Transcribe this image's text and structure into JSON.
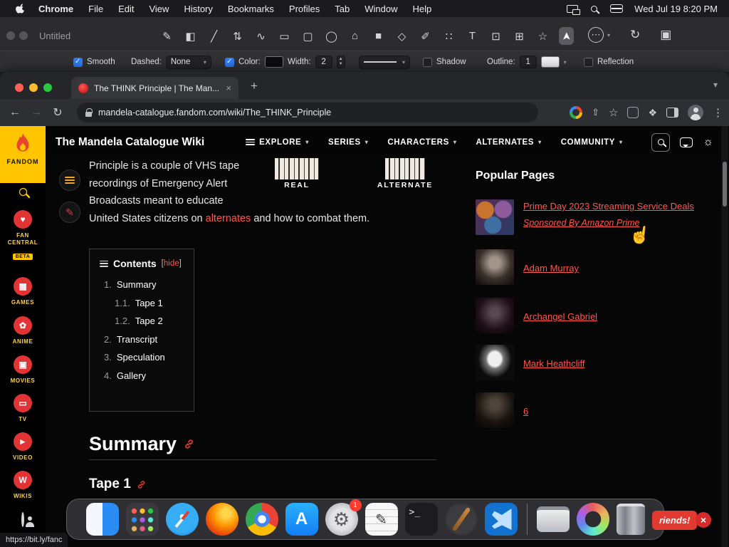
{
  "menubar": {
    "items": [
      "Chrome",
      "File",
      "Edit",
      "View",
      "History",
      "Bookmarks",
      "Profiles",
      "Tab",
      "Window",
      "Help"
    ],
    "clock": "Wed Jul 19 8:20 PM"
  },
  "icons": {
    "back": "←",
    "forward": "→",
    "reload": "↻",
    "plus": "+",
    "tab_close": "×",
    "chevron": "▾",
    "kebab": "⋮",
    "star": "☆",
    "share": "⇧",
    "puzzle": "❖",
    "sun": "☼",
    "heart": "♥",
    "hand_cursor": "☝",
    "close": "×",
    "pencil": "✎",
    "more": "⋯",
    "redo": "↻",
    "image": "▣",
    "stepper_up": "▲",
    "stepper_down": "▼"
  },
  "annotator": {
    "window_title": "Untitled",
    "tools": [
      {
        "name": "pencil",
        "glyph": "✎"
      },
      {
        "name": "fill",
        "glyph": "◧"
      },
      {
        "name": "line",
        "glyph": "╱"
      },
      {
        "name": "arrow",
        "glyph": "⇅"
      },
      {
        "name": "curve",
        "glyph": "∿"
      },
      {
        "name": "rectangle",
        "glyph": "▭"
      },
      {
        "name": "rounded-rectangle",
        "glyph": "▢"
      },
      {
        "name": "ellipse",
        "glyph": "◯"
      },
      {
        "name": "polygon",
        "glyph": "⌂"
      },
      {
        "name": "filled-square",
        "glyph": "■"
      },
      {
        "name": "eraser",
        "glyph": "◇"
      },
      {
        "name": "marker",
        "glyph": "✐"
      },
      {
        "name": "spray",
        "glyph": "∷"
      },
      {
        "name": "text",
        "glyph": "T"
      },
      {
        "name": "crop",
        "glyph": "⊡"
      },
      {
        "name": "frame",
        "glyph": "⊞"
      },
      {
        "name": "star-shape",
        "glyph": "☆"
      },
      {
        "name": "select",
        "glyph": "➤"
      }
    ],
    "options": {
      "smooth": "Smooth",
      "dashed_label": "Dashed:",
      "dashed_value": "None",
      "color_label": "Color:",
      "width_label": "Width:",
      "width_value": "2",
      "shadow": "Shadow",
      "outline_label": "Outline:",
      "outline_value": "1",
      "reflection": "Reflection"
    }
  },
  "browser": {
    "tab_title": "The THINK Principle | The Man...",
    "url": "mandela-catalogue.fandom.com/wiki/The_THINK_Principle",
    "status_link": "https://bit.ly/fanc"
  },
  "rail": {
    "brand": "FANDOM",
    "fan_central_line1": "FAN",
    "fan_central_line2": "CENTRAL",
    "beta": "BETA",
    "items": [
      {
        "label": "GAMES",
        "glyph": "▦"
      },
      {
        "label": "ANIME",
        "glyph": "✿"
      },
      {
        "label": "MOVIES",
        "glyph": "▣"
      },
      {
        "label": "TV",
        "glyph": "▭"
      },
      {
        "label": "VIDEO",
        "glyph": "►"
      },
      {
        "label": "WIKIS",
        "glyph": "W"
      }
    ]
  },
  "wiki": {
    "title": "The Mandela Catalogue Wiki",
    "nav": [
      "EXPLORE",
      "SERIES",
      "CHARACTERS",
      "ALTERNATES",
      "COMMUNITY"
    ]
  },
  "article": {
    "intro": {
      "line1": "Principle is a couple of VHS tape",
      "line2": "recordings of Emergency Alert",
      "line3": "Broadcasts meant to educate",
      "line4_pre": "United States citizens on ",
      "link": "alternates",
      "line4_post": " and how to combat them."
    },
    "labels": {
      "real": "REAL",
      "alternate": "ALTERNATE"
    },
    "toc": {
      "title": "Contents",
      "hide": "hide",
      "items": [
        {
          "num": "1.",
          "label": "Summary"
        },
        {
          "num": "1.1.",
          "label": "Tape 1"
        },
        {
          "num": "1.2.",
          "label": "Tape 2"
        },
        {
          "num": "2.",
          "label": "Transcript"
        },
        {
          "num": "3.",
          "label": "Speculation"
        },
        {
          "num": "4.",
          "label": "Gallery"
        }
      ]
    },
    "headings": {
      "summary": "Summary",
      "tape1": "Tape 1"
    }
  },
  "popular": {
    "heading": "Popular Pages",
    "items": [
      {
        "title": "Prime Day 2023 Streaming Service Deals",
        "subtitle": "Sponsored By Amazon Prime"
      },
      {
        "title": "Adam Murray"
      },
      {
        "title": "Archangel Gabriel"
      },
      {
        "title": "Mark Heathcliff"
      },
      {
        "title": "6"
      }
    ]
  },
  "dock": {
    "appstore_glyph": "A",
    "terminal_glyph": ">_",
    "settings_badge": "1"
  },
  "banner": {
    "text": "riends!"
  }
}
